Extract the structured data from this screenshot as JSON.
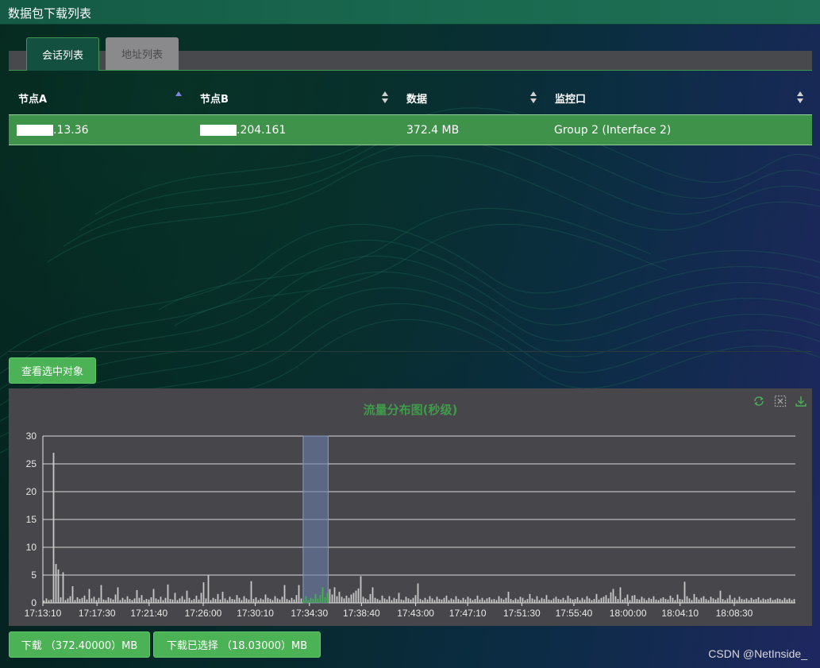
{
  "window": {
    "title": "数据包下载列表"
  },
  "tabs": [
    {
      "label": "会话列表",
      "active": true
    },
    {
      "label": "地址列表",
      "active": false
    }
  ],
  "table": {
    "columns": [
      {
        "label": "节点A",
        "sort": "asc"
      },
      {
        "label": "节点B",
        "sort": "none"
      },
      {
        "label": "数据",
        "sort": "none"
      },
      {
        "label": "监控口",
        "sort": "none"
      }
    ],
    "rows": [
      {
        "node_a": ".13.36",
        "node_b": ".204.161",
        "data": "372.4 MB",
        "port": "Group 2 (Interface 2)",
        "selected": true
      }
    ]
  },
  "buttons": {
    "view_selected": "查看选中对象",
    "download": "下载  （372.40000）MB",
    "download_selected": "下载已选择  （18.03000）MB"
  },
  "toolbox": {
    "icons": [
      "restore-icon",
      "zoom-select-icon",
      "save-image-icon"
    ]
  },
  "watermark": "CSDN @NetInside_",
  "colors": {
    "accent_green": "#4bb356",
    "title_green": "#3f9a4a",
    "bar_gray": "#c8c8c8",
    "bar_selected": "#3fb24a",
    "brush_fill": "#6b7fa8"
  },
  "chart_data": {
    "type": "bar",
    "title": "流量分布图(秒级)",
    "xlabel": "",
    "ylabel": "",
    "ylim": [
      0,
      30
    ],
    "yticks": [
      0,
      5,
      10,
      15,
      20,
      25,
      30
    ],
    "x_tick_labels": [
      "17:13:10",
      "17:17:30",
      "17:21:40",
      "17:26:00",
      "17:30:10",
      "17:34:30",
      "17:38:40",
      "17:43:00",
      "17:47:10",
      "17:51:30",
      "17:55:40",
      "18:00:00",
      "18:04:10",
      "18:08:30"
    ],
    "grid": true,
    "brush_range": [
      "17:34:00",
      "17:36:00"
    ],
    "series": [
      {
        "values": [
          0.4,
          0.8,
          0.5,
          0.6,
          27,
          7,
          6,
          1,
          5.5,
          0.5,
          0.8,
          1.2,
          3,
          0.5,
          1,
          0.7,
          0.9,
          1.3,
          0.6,
          2.5,
          0.8,
          1.1,
          0.5,
          0.9,
          3.2,
          0.6,
          0.5,
          1,
          0.8,
          0.6,
          1.5,
          2.8,
          0.5,
          0.9,
          0.6,
          1.2,
          0.7,
          0.5,
          0.8,
          2.3,
          0.9,
          1.4,
          0.5,
          0.7,
          0.6,
          1,
          2.5,
          0.8,
          0.6,
          1.1,
          0.5,
          0.9,
          3.3,
          0.7,
          0.6,
          1.8,
          0.5,
          0.8,
          1.2,
          0.6,
          2.2,
          0.9,
          0.5,
          0.7,
          1.3,
          0.6,
          1.8,
          3.7,
          0.8,
          5,
          0.5,
          0.9,
          0.7,
          1.6,
          0.6,
          2,
          0.8,
          0.5,
          1.1,
          0.7,
          0.6,
          1.4,
          0.9,
          0.5,
          1.2,
          0.8,
          0.6,
          3.9,
          0.7,
          1,
          0.5,
          0.8,
          0.6,
          1.5,
          0.9,
          0.7,
          0.5,
          1.2,
          0.8,
          0.6,
          1.1,
          3.2,
          0.7,
          0.5,
          0.9,
          0.6,
          1.4,
          3.2,
          0.8,
          0.6,
          1.2,
          0.5,
          0.9,
          0.7,
          1.6,
          0.8,
          1.4,
          2.8,
          1,
          1.8,
          2.5,
          1.5,
          2.8,
          1.2,
          2,
          1.1,
          0.8,
          1.3,
          0.9,
          1.5,
          1.8,
          2.2,
          2.6,
          4.8,
          1.1,
          0.8,
          0.6,
          1.6,
          2.8,
          0.9,
          0.7,
          0.5,
          1.3,
          0.8,
          0.6,
          1.2,
          0.5,
          0.9,
          0.7,
          1.8,
          0.6,
          0.5,
          1.1,
          0.8,
          0.6,
          0.9,
          1.4,
          3.5,
          0.7,
          0.5,
          0.9,
          0.6,
          1.2,
          0.8,
          0.5,
          1.1,
          0.7,
          0.6,
          0.9,
          1.3,
          0.5,
          0.8,
          0.6,
          1.2,
          0.7,
          0.5,
          0.9,
          0.6,
          1.1,
          0.8,
          0.5,
          0.7,
          1.3,
          0.6,
          0.9,
          0.5,
          0.8,
          1,
          0.6,
          0.7,
          0.5,
          1.2,
          0.8,
          0.6,
          0.9,
          2,
          0.7,
          0.5,
          0.8,
          0.6,
          1.1,
          0.9,
          0.5,
          0.7,
          1.6,
          0.8,
          0.6,
          1.2,
          0.5,
          0.9,
          0.7,
          1.4,
          0.6,
          0.5,
          0.8,
          1.1,
          0.7,
          0.6,
          0.9,
          0.5,
          1.3,
          0.8,
          0.6,
          0.7,
          1,
          0.5,
          0.9,
          0.6,
          1.2,
          0.8,
          0.5,
          0.7,
          1.6,
          0.6,
          0.9,
          1.1,
          1.4,
          0.8,
          1.9,
          2.5,
          1.2,
          0.7,
          2.8,
          0.6,
          0.9,
          1.5,
          0.5,
          1.3,
          1.4,
          0.7,
          0.6,
          1.1,
          0.8,
          0.5,
          0.9,
          0.7,
          1.2,
          0.6,
          0.5,
          0.8,
          1,
          0.7,
          0.6,
          1.3,
          0.9,
          0.5,
          1.5,
          0.7,
          0.6,
          3.8,
          1.2,
          0.8,
          0.5,
          1.6,
          1,
          0.6,
          0.9,
          1.2,
          0.7,
          0.5,
          1.1,
          0.8,
          0.6,
          0.9,
          2.2,
          0.7,
          0.5,
          0.8,
          1.4,
          0.6,
          0.9,
          0.5,
          1.1,
          0.7,
          0.6,
          0.8,
          0.5,
          0.9,
          0.6,
          0.7,
          1,
          0.5,
          0.8,
          0.6,
          0.7,
          0.9,
          0.5,
          0.6,
          0.8,
          0.7,
          0.5,
          0.9,
          0.6,
          0.8,
          0.5,
          0.7
        ]
      }
    ]
  }
}
